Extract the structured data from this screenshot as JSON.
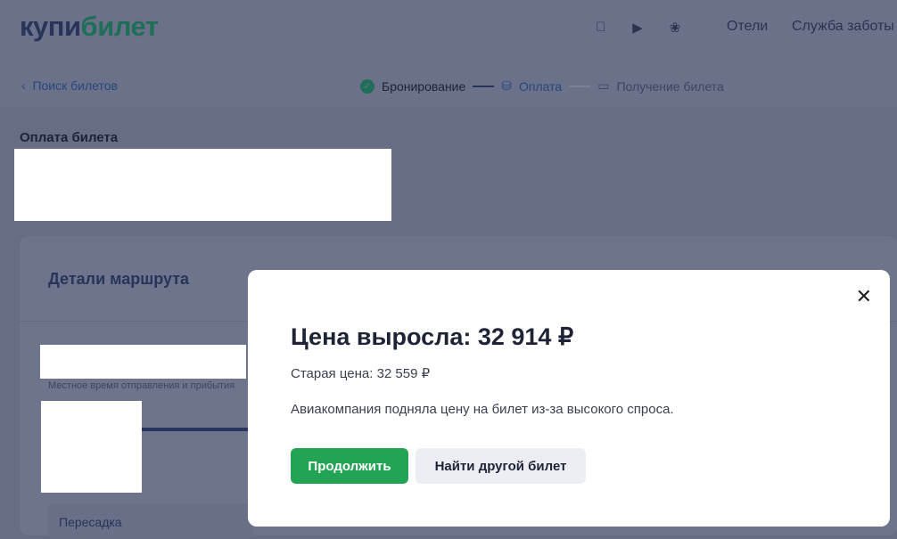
{
  "header": {
    "logo_part1": "купи",
    "logo_part2": "билет",
    "icons": [
      "apple-icon",
      "google-play-icon",
      "huawei-icon"
    ],
    "nav": [
      "Отели",
      "Служба заботы"
    ]
  },
  "breadcrumb": {
    "back": "Поиск билетов"
  },
  "steps": [
    {
      "label": "Бронирование",
      "state": "done"
    },
    {
      "label": "Оплата",
      "state": "active"
    },
    {
      "label": "Получение билета",
      "state": "pending"
    }
  ],
  "page": {
    "title": "Оплата билета",
    "route_title": "Детали маршрута",
    "local_time_note": "Местное время отправления и прибытия",
    "transfer": "Пересадка"
  },
  "modal": {
    "title": "Цена выросла: 32 914 ₽",
    "old_price": "Старая цена: 32 559 ₽",
    "message": "Авиакомпания подняла цену на билет из-за высокого спроса.",
    "continue": "Продолжить",
    "find_other": "Найти другой билет"
  },
  "colors": {
    "accent": "#23a455",
    "brand": "#1f6e58"
  }
}
